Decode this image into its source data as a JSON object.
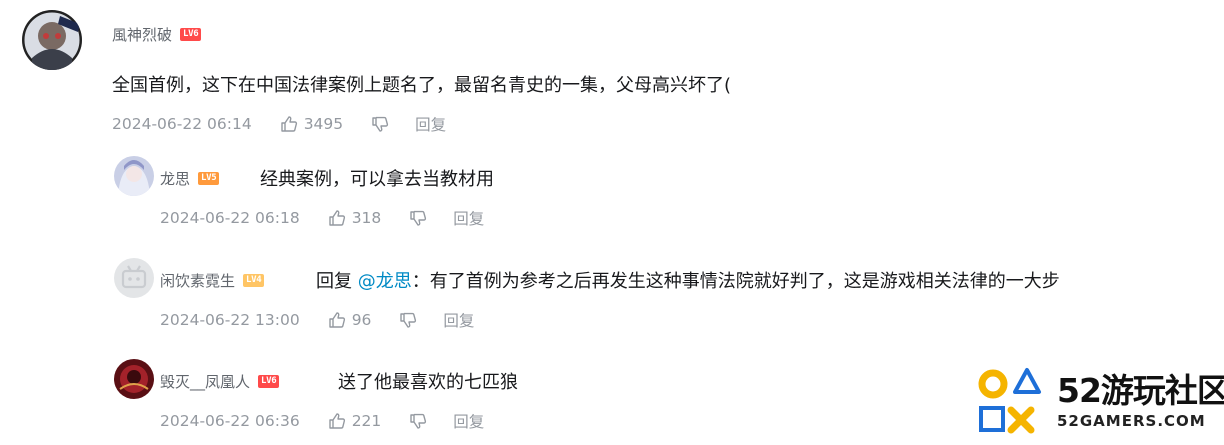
{
  "main_comment": {
    "username": "風神烈破",
    "level": "LV6",
    "content": "全国首例，这下在中国法律案例上题名了，最留名青史的一集，父母高兴坏了(",
    "time": "2024-06-22 06:14",
    "likes": "3495",
    "reply_label": "回复"
  },
  "replies": [
    {
      "username": "龙思",
      "level": "LV5",
      "content": "经典案例，可以拿去当教材用",
      "time": "2024-06-22 06:18",
      "likes": "318",
      "reply_label": "回复"
    },
    {
      "username": "闲饮素霓生",
      "level": "LV4",
      "reply_prefix": "回复 ",
      "mention": "@龙思",
      "content": "：有了首例为参考之后再发生这种事情法院就好判了，这是游戏相关法律的一大步",
      "time": "2024-06-22 13:00",
      "likes": "96",
      "reply_label": "回复"
    },
    {
      "username": "毁灭__凤凰人",
      "level": "LV6",
      "content": "送了他最喜欢的七匹狼",
      "time": "2024-06-22 06:36",
      "likes": "221",
      "reply_label": "回复"
    }
  ],
  "watermark": {
    "main": "52游玩社区",
    "sub": "52GAMERS.COM"
  },
  "colors": {
    "meta_gray": "#9499a0",
    "name_gray": "#61666d",
    "mention_blue": "#008ac5",
    "lv6": "#ff4a4a",
    "lv5": "#ff9a3c",
    "lv4": "#ffc565",
    "brand_yellow": "#f5b400",
    "brand_blue": "#1e6fd8"
  }
}
